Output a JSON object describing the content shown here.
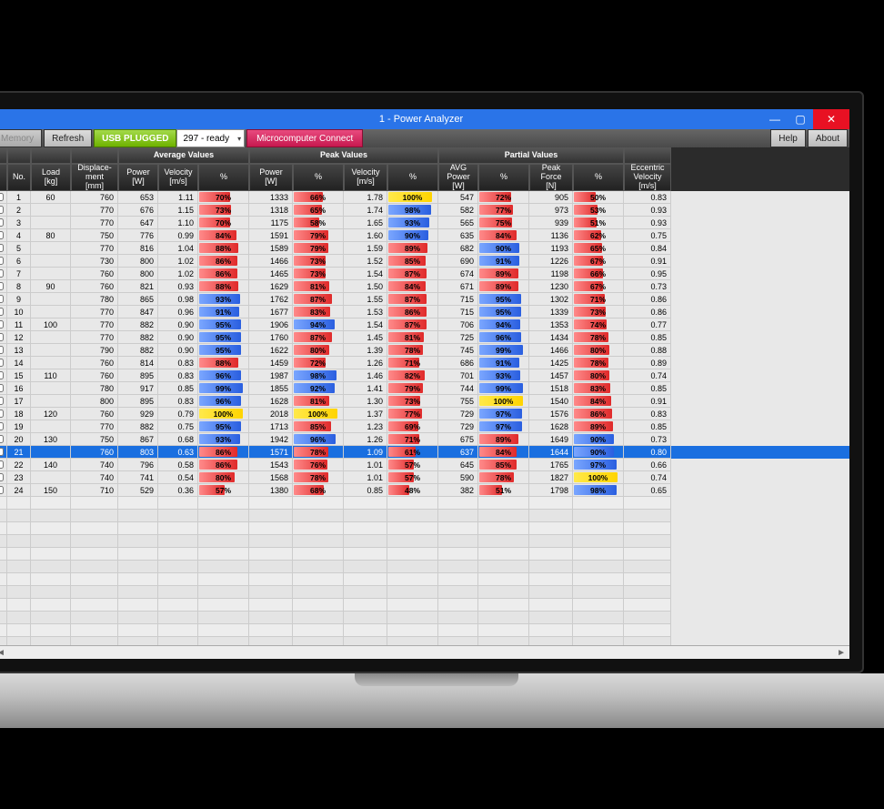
{
  "window": {
    "title": "1 - Power Analyzer"
  },
  "toolbar": {
    "memory": "Memory",
    "refresh": "Refresh",
    "usb": "USB PLUGGED",
    "device": "297 - ready",
    "micro": "Microcomputer Connect",
    "help": "Help",
    "about": "About"
  },
  "headers": {
    "groups": [
      "",
      "",
      "",
      "",
      "Average Values",
      "Peak Values",
      "Partial Values",
      ""
    ],
    "cols": {
      "no": "No.",
      "load": "Load\n[kg]",
      "disp": "Displace-\nment\n[mm]",
      "apw": "Power\n[W]",
      "avel": "Velocity\n[m/s]",
      "apct": "%",
      "ppw": "Power\n[W]",
      "ppct": "%",
      "pvel": "Velocity\n[m/s]",
      "pvpct": "%",
      "pavg": "AVG\nPower\n[W]",
      "pavgpct": "%",
      "pf": "Peak\nForce\n[N]",
      "pfpct": "%",
      "evel": "Eccentric\nVelocity\n[m/s]"
    }
  },
  "rows": [
    {
      "no": 1,
      "load": 60,
      "disp": 760,
      "apw": 653,
      "avel": "1.11",
      "apct": 70,
      "ppw": 1333,
      "ppct": 66,
      "pvel": "1.78",
      "pvpct": 100,
      "pvpctc": "y",
      "pavg": 547,
      "pavgpct": 72,
      "pf": 905,
      "pfpct": 50,
      "evel": "0.83"
    },
    {
      "no": 2,
      "load": "",
      "disp": 770,
      "apw": 676,
      "avel": "1.15",
      "apct": 73,
      "ppw": 1318,
      "ppct": 65,
      "pvel": "1.74",
      "pvpct": 98,
      "pvpctc": "b",
      "pavg": 582,
      "pavgpct": 77,
      "pf": 973,
      "pfpct": 53,
      "evel": "0.93"
    },
    {
      "no": 3,
      "load": "",
      "disp": 770,
      "apw": 647,
      "avel": "1.10",
      "apct": 70,
      "ppw": 1175,
      "ppct": 58,
      "pvel": "1.65",
      "pvpct": 93,
      "pvpctc": "b",
      "pavg": 565,
      "pavgpct": 75,
      "pf": 939,
      "pfpct": 51,
      "evel": "0.93"
    },
    {
      "no": 4,
      "load": 80,
      "disp": 750,
      "apw": 776,
      "avel": "0.99",
      "apct": 84,
      "ppw": 1591,
      "ppct": 79,
      "pvel": "1.60",
      "pvpct": 90,
      "pvpctc": "b",
      "pavg": 635,
      "pavgpct": 84,
      "pf": 1136,
      "pfpct": 62,
      "evel": "0.75"
    },
    {
      "no": 5,
      "load": "",
      "disp": 770,
      "apw": 816,
      "avel": "1.04",
      "apct": 88,
      "ppw": 1589,
      "ppct": 79,
      "pvel": "1.59",
      "pvpct": 89,
      "pavg": 682,
      "pavgpct": 90,
      "pavgpctc": "b",
      "pf": 1193,
      "pfpct": 65,
      "evel": "0.84"
    },
    {
      "no": 6,
      "load": "",
      "disp": 730,
      "apw": 800,
      "avel": "1.02",
      "apct": 86,
      "ppw": 1466,
      "ppct": 73,
      "pvel": "1.52",
      "pvpct": 85,
      "pavg": 690,
      "pavgpct": 91,
      "pavgpctc": "b",
      "pf": 1226,
      "pfpct": 67,
      "evel": "0.91"
    },
    {
      "no": 7,
      "load": "",
      "disp": 760,
      "apw": 800,
      "avel": "1.02",
      "apct": 86,
      "ppw": 1465,
      "ppct": 73,
      "pvel": "1.54",
      "pvpct": 87,
      "pavg": 674,
      "pavgpct": 89,
      "pf": 1198,
      "pfpct": 66,
      "evel": "0.95"
    },
    {
      "no": 8,
      "load": 90,
      "disp": 760,
      "apw": 821,
      "avel": "0.93",
      "apct": 88,
      "ppw": 1629,
      "ppct": 81,
      "pvel": "1.50",
      "pvpct": 84,
      "pavg": 671,
      "pavgpct": 89,
      "pf": 1230,
      "pfpct": 67,
      "evel": "0.73"
    },
    {
      "no": 9,
      "load": "",
      "disp": 780,
      "apw": 865,
      "avel": "0.98",
      "apct": 93,
      "apctc": "b",
      "ppw": 1762,
      "ppct": 87,
      "pvel": "1.55",
      "pvpct": 87,
      "pavg": 715,
      "pavgpct": 95,
      "pavgpctc": "b",
      "pf": 1302,
      "pfpct": 71,
      "evel": "0.86"
    },
    {
      "no": 10,
      "load": "",
      "disp": 770,
      "apw": 847,
      "avel": "0.96",
      "apct": 91,
      "apctc": "b",
      "ppw": 1677,
      "ppct": 83,
      "pvel": "1.53",
      "pvpct": 86,
      "pavg": 715,
      "pavgpct": 95,
      "pavgpctc": "b",
      "pf": 1339,
      "pfpct": 73,
      "evel": "0.86"
    },
    {
      "no": 11,
      "load": 100,
      "disp": 770,
      "apw": 882,
      "avel": "0.90",
      "apct": 95,
      "apctc": "b",
      "ppw": 1906,
      "ppct": 94,
      "ppctc": "b",
      "pvel": "1.54",
      "pvpct": 87,
      "pavg": 706,
      "pavgpct": 94,
      "pavgpctc": "b",
      "pf": 1353,
      "pfpct": 74,
      "evel": "0.77"
    },
    {
      "no": 12,
      "load": "",
      "disp": 770,
      "apw": 882,
      "avel": "0.90",
      "apct": 95,
      "apctc": "b",
      "ppw": 1760,
      "ppct": 87,
      "pvel": "1.45",
      "pvpct": 81,
      "pavg": 725,
      "pavgpct": 96,
      "pavgpctc": "b",
      "pf": 1434,
      "pfpct": 78,
      "evel": "0.85"
    },
    {
      "no": 13,
      "load": "",
      "disp": 790,
      "apw": 882,
      "avel": "0.90",
      "apct": 95,
      "apctc": "b",
      "ppw": 1622,
      "ppct": 80,
      "pvel": "1.39",
      "pvpct": 78,
      "pavg": 745,
      "pavgpct": 99,
      "pavgpctc": "b",
      "pf": 1466,
      "pfpct": 80,
      "evel": "0.88"
    },
    {
      "no": 14,
      "load": "",
      "disp": 760,
      "apw": 814,
      "avel": "0.83",
      "apct": 88,
      "ppw": 1459,
      "ppct": 72,
      "pvel": "1.26",
      "pvpct": 71,
      "pavg": 686,
      "pavgpct": 91,
      "pavgpctc": "b",
      "pf": 1425,
      "pfpct": 78,
      "evel": "0.89"
    },
    {
      "no": 15,
      "load": 110,
      "disp": 760,
      "apw": 895,
      "avel": "0.83",
      "apct": 96,
      "apctc": "b",
      "ppw": 1987,
      "ppct": 98,
      "ppctc": "b",
      "pvel": "1.46",
      "pvpct": 82,
      "pavg": 701,
      "pavgpct": 93,
      "pavgpctc": "b",
      "pf": 1457,
      "pfpct": 80,
      "evel": "0.74"
    },
    {
      "no": 16,
      "load": "",
      "disp": 780,
      "apw": 917,
      "avel": "0.85",
      "apct": 99,
      "apctc": "b",
      "ppw": 1855,
      "ppct": 92,
      "ppctc": "b",
      "pvel": "1.41",
      "pvpct": 79,
      "pavg": 744,
      "pavgpct": 99,
      "pavgpctc": "b",
      "pf": 1518,
      "pfpct": 83,
      "evel": "0.85"
    },
    {
      "no": 17,
      "load": "",
      "disp": 800,
      "apw": 895,
      "avel": "0.83",
      "apct": 96,
      "apctc": "b",
      "ppw": 1628,
      "ppct": 81,
      "pvel": "1.30",
      "pvpct": 73,
      "pavg": 755,
      "pavgpct": 100,
      "pavgpctc": "y",
      "pf": 1540,
      "pfpct": 84,
      "evel": "0.91"
    },
    {
      "no": 18,
      "load": 120,
      "disp": 760,
      "apw": 929,
      "avel": "0.79",
      "apct": 100,
      "apctc": "y",
      "ppw": 2018,
      "ppct": 100,
      "ppctc": "y",
      "pvel": "1.37",
      "pvpct": 77,
      "pavg": 729,
      "pavgpct": 97,
      "pavgpctc": "b",
      "pf": 1576,
      "pfpct": 86,
      "evel": "0.83"
    },
    {
      "no": 19,
      "load": "",
      "disp": 770,
      "apw": 882,
      "avel": "0.75",
      "apct": 95,
      "apctc": "b",
      "ppw": 1713,
      "ppct": 85,
      "pvel": "1.23",
      "pvpct": 69,
      "pavg": 729,
      "pavgpct": 97,
      "pavgpctc": "b",
      "pf": 1628,
      "pfpct": 89,
      "evel": "0.85"
    },
    {
      "no": 20,
      "load": 130,
      "disp": 750,
      "apw": 867,
      "avel": "0.68",
      "apct": 93,
      "apctc": "b",
      "ppw": 1942,
      "ppct": 96,
      "ppctc": "b",
      "pvel": "1.26",
      "pvpct": 71,
      "pavg": 675,
      "pavgpct": 89,
      "pf": 1649,
      "pfpct": 90,
      "pfpctc": "b",
      "evel": "0.73"
    },
    {
      "no": 21,
      "load": "",
      "disp": 760,
      "apw": 803,
      "avel": "0.63",
      "apct": 86,
      "ppw": 1571,
      "ppct": 78,
      "pvel": "1.09",
      "pvpct": 61,
      "pavg": 637,
      "pavgpct": 84,
      "pf": 1644,
      "pfpct": 90,
      "pfpctc": "b",
      "evel": "0.80",
      "sel": true
    },
    {
      "no": 22,
      "load": 140,
      "disp": 740,
      "apw": 796,
      "avel": "0.58",
      "apct": 86,
      "ppw": 1543,
      "ppct": 76,
      "pvel": "1.01",
      "pvpct": 57,
      "pavg": 645,
      "pavgpct": 85,
      "pf": 1765,
      "pfpct": 97,
      "pfpctc": "b",
      "evel": "0.66"
    },
    {
      "no": 23,
      "load": "",
      "disp": 740,
      "apw": 741,
      "avel": "0.54",
      "apct": 80,
      "ppw": 1568,
      "ppct": 78,
      "pvel": "1.01",
      "pvpct": 57,
      "pavg": 590,
      "pavgpct": 78,
      "pf": 1827,
      "pfpct": 100,
      "pfpctc": "y",
      "evel": "0.74"
    },
    {
      "no": 24,
      "load": 150,
      "disp": 710,
      "apw": 529,
      "avel": "0.36",
      "apct": 57,
      "ppw": 1380,
      "ppct": 68,
      "pvel": "0.85",
      "pvpct": 48,
      "pavg": 382,
      "pavgpct": 51,
      "pf": 1798,
      "pfpct": 98,
      "pfpctc": "b",
      "evel": "0.65"
    }
  ],
  "blankRowCount": 20
}
